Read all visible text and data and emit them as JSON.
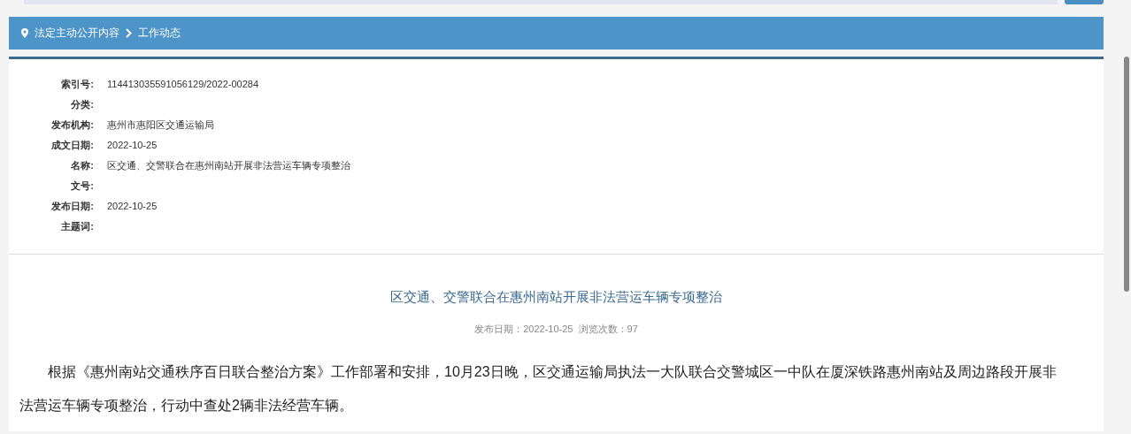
{
  "breadcrumb": {
    "items": [
      {
        "label": "法定主动公开内容"
      },
      {
        "label": "工作动态"
      }
    ]
  },
  "meta": [
    {
      "label": "索引号:",
      "value": "114413035591056129/2022-00284"
    },
    {
      "label": "分类:"
    },
    {
      "label": "发布机构:",
      "value": "惠州市惠阳区交通运输局"
    },
    {
      "label": "成文日期:",
      "value": "2022-10-25"
    },
    {
      "label": "名称:",
      "value": "区交通、交警联合在惠州南站开展非法营运车辆专项整治"
    },
    {
      "label": "文号:"
    },
    {
      "label": "发布日期:",
      "value": "2022-10-25"
    },
    {
      "label": "主题词:"
    }
  ],
  "article": {
    "title": "区交通、交警联合在惠州南站开展非法营运车辆专项整治",
    "info": "发布日期：2022-10-25  浏览次数：97",
    "paragraphs": [
      "根据《惠州南站交通秩序百日联合整治方案》工作部署和安排，10月23日晚，区交通运输局执法一大队联合交警城区一中队在厦深铁路惠州南站及周边路段开展非法营运车辆专项整治，行动中查处2辆非法经营车辆。"
    ]
  }
}
